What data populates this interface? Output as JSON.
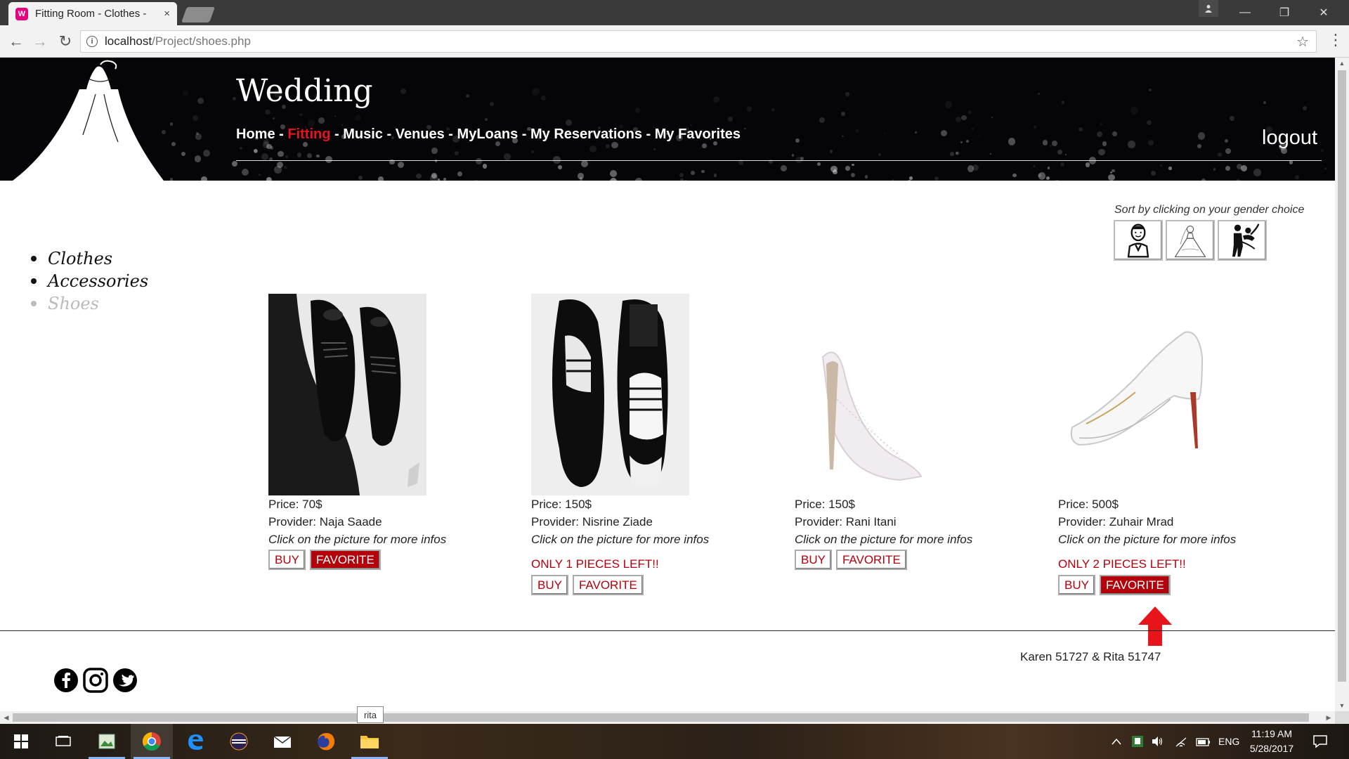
{
  "browser": {
    "tab_title": "Fitting Room - Clothes -",
    "tab_close": "×",
    "url_host": "localhost",
    "url_path": "/Project/shoes.php"
  },
  "site": {
    "title": "Wedding",
    "nav": [
      {
        "label": "Home",
        "active": false
      },
      {
        "label": "Fitting",
        "active": true
      },
      {
        "label": "Music",
        "active": false
      },
      {
        "label": "Venues",
        "active": false
      },
      {
        "label": "MyLoans",
        "active": false
      },
      {
        "label": "My Reservations",
        "active": false
      },
      {
        "label": "My Favorites",
        "active": false
      }
    ],
    "nav_separator": " - ",
    "logout": "logout"
  },
  "sort": {
    "caption": "Sort by clicking on your gender choice",
    "options": [
      "groom-icon",
      "bride-icon",
      "couple-icon"
    ]
  },
  "categories": [
    {
      "label": "Clothes",
      "active": true
    },
    {
      "label": "Accessories",
      "active": true
    },
    {
      "label": "Shoes",
      "active": false
    }
  ],
  "products": [
    {
      "price": "Price: 70$",
      "provider": "Provider: Naja Saade",
      "hint": "Click on the picture for more infos",
      "stock": "",
      "buy": "BUY",
      "favorite": "FAVORITE",
      "favorited": true,
      "image": "men-black-shoes-on-feet"
    },
    {
      "price": "Price: 150$",
      "provider": "Provider: Nisrine Ziade",
      "hint": "Click on the picture for more infos",
      "stock": "ONLY 1 PIECES LEFT!!",
      "buy": "BUY",
      "favorite": "FAVORITE",
      "favorited": false,
      "image": "men-black-and-white-wingtip-shoes"
    },
    {
      "price": "Price: 150$",
      "provider": "Provider: Rani Itani",
      "hint": "Click on the picture for more infos",
      "stock": "",
      "buy": "BUY",
      "favorite": "FAVORITE",
      "favorited": false,
      "image": "white-lace-stiletto-pump"
    },
    {
      "price": "Price: 500$",
      "provider": "Provider: Zuhair Mrad",
      "hint": "Click on the picture for more infos",
      "stock": "ONLY 2 PIECES LEFT!!",
      "buy": "BUY",
      "favorite": "FAVORITE",
      "favorited": true,
      "image": "white-patent-stiletto-pump"
    }
  ],
  "footer": {
    "credits": "Karen 51727 & Rita 51747",
    "social": [
      "facebook-icon",
      "instagram-icon",
      "twitter-icon"
    ]
  },
  "tooltip": "rita",
  "taskbar": {
    "language": "ENG",
    "time": "11:19 AM",
    "date": "5/28/2017"
  },
  "colors": {
    "accent_red": "#b3000b",
    "nav_active": "#e8141c",
    "banner_bg": "#050508"
  }
}
